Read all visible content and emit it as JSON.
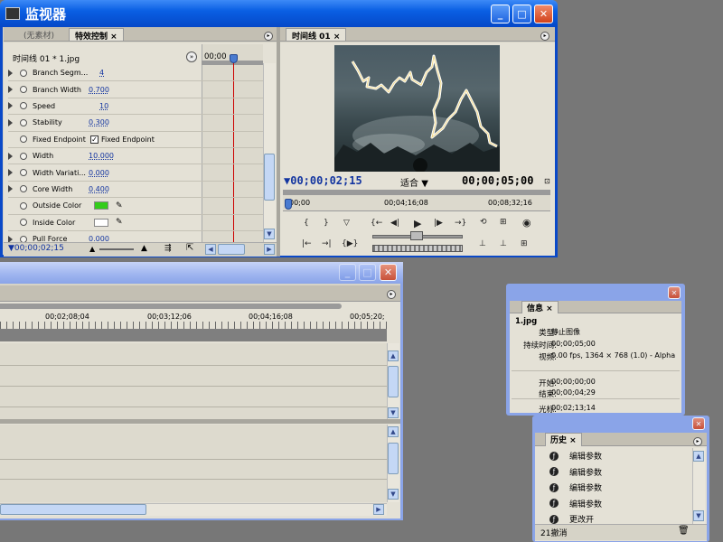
{
  "monitor": {
    "title": "监视器",
    "tab_no_clip": "(无素材)",
    "tab_effects": "特效控制",
    "tab_timeline": "时间线 01",
    "clip_header": "时间线 01 * 1.jpg",
    "effect_timecode_start": "00;00",
    "params": [
      {
        "label": "Branch Segm...",
        "value": "4",
        "expand": true
      },
      {
        "label": "Branch Width",
        "value": "0.700",
        "expand": true
      },
      {
        "label": "Speed",
        "value": "10",
        "expand": true
      },
      {
        "label": "Stability",
        "value": "0.300",
        "expand": true
      },
      {
        "label": "Fixed Endpoint",
        "value": "Fixed Endpoint",
        "expand": false,
        "checkbox": true
      },
      {
        "label": "Width",
        "value": "10.000",
        "expand": true
      },
      {
        "label": "Width Variati...",
        "value": "0.000",
        "expand": true
      },
      {
        "label": "Core Width",
        "value": "0.400",
        "expand": true
      },
      {
        "label": "Outside Color",
        "value": "",
        "expand": false,
        "color": "#33cc1a"
      },
      {
        "label": "Inside Color",
        "value": "",
        "expand": false,
        "color": "#ffffff"
      },
      {
        "label": "Pull Force",
        "value": "0.000",
        "expand": true
      }
    ],
    "effect_timecode_bottom": "00;00;02;15",
    "program_timecode": "00;00;02;15",
    "fit_label": "适合",
    "duration_timecode": "00;00;05;00",
    "ruler_labels": [
      "00;00",
      "00;04;16;08",
      "00;08;32;16"
    ]
  },
  "timeline": {
    "ruler_labels": [
      "00;02;08;04",
      "00;03;12;06",
      "00;04;16;08",
      "00;05;20;"
    ]
  },
  "info": {
    "tab": "信息",
    "filename": "1.jpg",
    "rows": [
      {
        "label": "类型:",
        "value": "静止图像"
      },
      {
        "label": "持续时间:",
        "value": "00;00;05;00"
      },
      {
        "label": "视频:",
        "value": "0.00 fps, 1364 × 768 (1.0) - Alpha"
      },
      {
        "label": "开始:",
        "value": "00;00;00;00"
      },
      {
        "label": "结束:",
        "value": "00;00;04;29"
      },
      {
        "label": "光标:",
        "value": "00;02;13;14"
      }
    ]
  },
  "history": {
    "tab": "历史",
    "items": [
      "编辑参数",
      "编辑参数",
      "编辑参数",
      "编辑参数",
      "更改开"
    ],
    "footer": "21撤消"
  },
  "colors": {
    "accent": "#0a5fe3",
    "timecode_blue": "#1234a0",
    "playhead": "#cc0000"
  }
}
